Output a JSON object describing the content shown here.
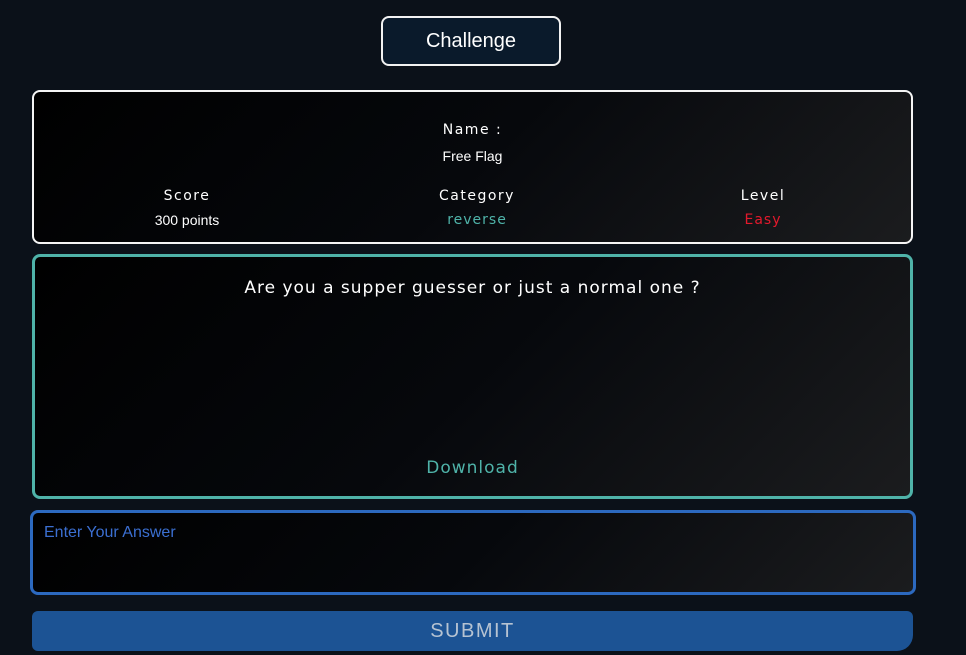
{
  "header": {
    "title": "Challenge"
  },
  "challenge": {
    "name_label": "Name :",
    "name_value": "Free Flag",
    "score_label": "Score",
    "score_value": "300 points",
    "category_label": "Category",
    "category_value": "reverse",
    "level_label": "Level",
    "level_value": "Easy",
    "description": "Are you a supper guesser or just a normal one ?",
    "download_label": "Download"
  },
  "answer": {
    "placeholder": "Enter Your Answer",
    "value": ""
  },
  "submit": {
    "label": "SUBMIT"
  },
  "colors": {
    "background": "#0b1119",
    "teal_accent": "#4fb3a9",
    "level_easy": "#e3192c",
    "input_border": "#2c69bf",
    "submit_bg": "#1c5394"
  }
}
